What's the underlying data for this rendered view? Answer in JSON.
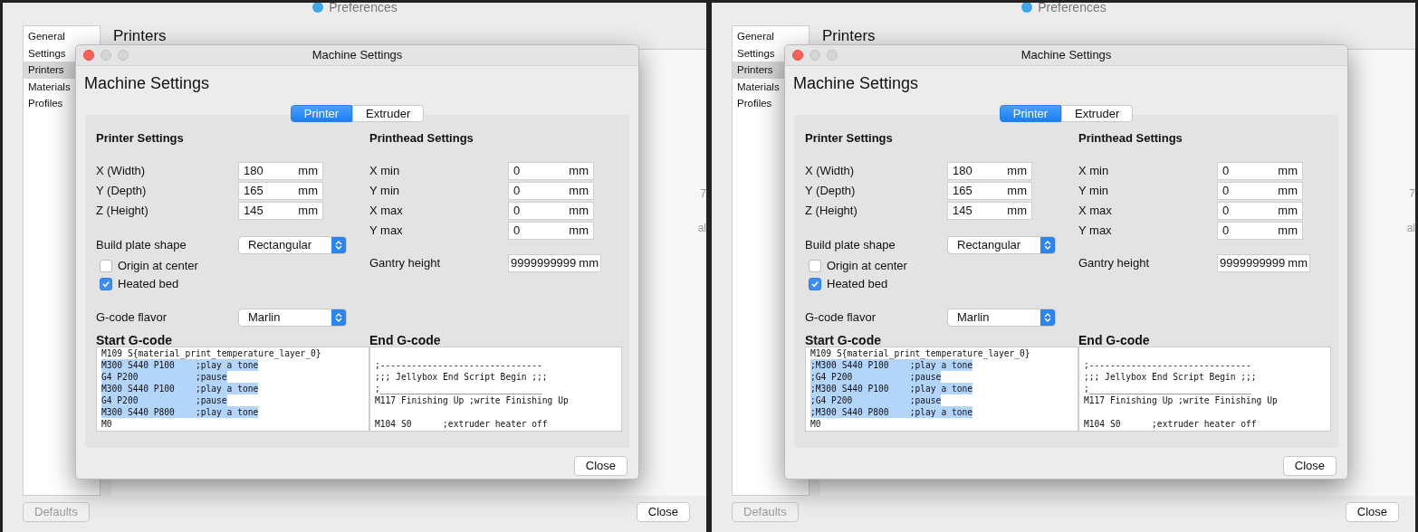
{
  "panels": [
    {
      "window_title": "Preferences",
      "sidebar": {
        "items": [
          {
            "label": "General",
            "selected": false
          },
          {
            "label": "Settings",
            "selected": false
          },
          {
            "label": "Printers",
            "selected": true
          },
          {
            "label": "Materials",
            "selected": false
          },
          {
            "label": "Profiles",
            "selected": false
          }
        ]
      },
      "heading": "Printers",
      "background_fragments": [
        "7",
        "al"
      ],
      "buttons": [
        "Defaults",
        "Close"
      ],
      "dialog": {
        "title": "Machine Settings",
        "heading": "Machine Settings",
        "tabs": [
          {
            "label": "Printer",
            "selected": true
          },
          {
            "label": "Extruder",
            "selected": false
          }
        ],
        "printer_settings": {
          "title": "Printer Settings",
          "fields": [
            {
              "label": "X (Width)",
              "value": "180",
              "unit": "mm"
            },
            {
              "label": "Y (Depth)",
              "value": "165",
              "unit": "mm"
            },
            {
              "label": "Z (Height)",
              "value": "145",
              "unit": "mm"
            }
          ],
          "build_plate_shape": {
            "label": "Build plate shape",
            "value": "Rectangular"
          },
          "checkboxes": [
            {
              "label": "Origin at center",
              "checked": false
            },
            {
              "label": "Heated bed",
              "checked": true
            }
          ],
          "gcode_flavor": {
            "label": "G-code flavor",
            "value": "Marlin"
          }
        },
        "printhead_settings": {
          "title": "Printhead Settings",
          "fields": [
            {
              "label": "X min",
              "value": "0",
              "unit": "mm"
            },
            {
              "label": "Y min",
              "value": "0",
              "unit": "mm"
            },
            {
              "label": "X max",
              "value": "0",
              "unit": "mm"
            },
            {
              "label": "Y max",
              "value": "0",
              "unit": "mm"
            }
          ],
          "gantry_height": {
            "label": "Gantry height",
            "value": "9999999999",
            "unit": "mm"
          }
        },
        "start_gcode": {
          "title": "Start G-code",
          "lines": [
            {
              "text": "M109 S{material_print_temperature_layer_0}",
              "selected": false
            },
            {
              "text": "M300 S440 P100    ;play a tone",
              "selected": true
            },
            {
              "text": "G4 P200           ;pause",
              "selected": true
            },
            {
              "text": "M300 S440 P100    ;play a tone",
              "selected": true
            },
            {
              "text": "G4 P200           ;pause",
              "selected": true
            },
            {
              "text": "M300 S440 P800    ;play a tone",
              "selected": true
            },
            {
              "text": "M0",
              "selected": false
            }
          ]
        },
        "end_gcode": {
          "title": "End G-code",
          "lines": [
            {
              "kind": "blank"
            },
            {
              "kind": "text",
              "text": ";-------------------------------"
            },
            {
              "kind": "text",
              "text": ";;; Jellybox End Script Begin ;;;"
            },
            {
              "kind": "text",
              "text": ";_______________________________"
            },
            {
              "kind": "text",
              "text": "M117 Finishing Up ;write Finishing Up"
            },
            {
              "kind": "blank"
            },
            {
              "kind": "text",
              "text": "M104 S0      ;extruder heater off"
            }
          ]
        },
        "close_button": "Close"
      }
    },
    {
      "window_title": "Preferences",
      "sidebar": {
        "items": [
          {
            "label": "General",
            "selected": false
          },
          {
            "label": "Settings",
            "selected": false
          },
          {
            "label": "Printers",
            "selected": true
          },
          {
            "label": "Materials",
            "selected": false
          },
          {
            "label": "Profiles",
            "selected": false
          }
        ]
      },
      "heading": "Printers",
      "background_fragments": [
        "7",
        "al"
      ],
      "buttons": [
        "Defaults",
        "Close"
      ],
      "dialog": {
        "title": "Machine Settings",
        "heading": "Machine Settings",
        "tabs": [
          {
            "label": "Printer",
            "selected": true
          },
          {
            "label": "Extruder",
            "selected": false
          }
        ],
        "printer_settings": {
          "title": "Printer Settings",
          "fields": [
            {
              "label": "X (Width)",
              "value": "180",
              "unit": "mm"
            },
            {
              "label": "Y (Depth)",
              "value": "165",
              "unit": "mm"
            },
            {
              "label": "Z (Height)",
              "value": "145",
              "unit": "mm"
            }
          ],
          "build_plate_shape": {
            "label": "Build plate shape",
            "value": "Rectangular"
          },
          "checkboxes": [
            {
              "label": "Origin at center",
              "checked": false
            },
            {
              "label": "Heated bed",
              "checked": true
            }
          ],
          "gcode_flavor": {
            "label": "G-code flavor",
            "value": "Marlin"
          }
        },
        "printhead_settings": {
          "title": "Printhead Settings",
          "fields": [
            {
              "label": "X min",
              "value": "0",
              "unit": "mm"
            },
            {
              "label": "Y min",
              "value": "0",
              "unit": "mm"
            },
            {
              "label": "X max",
              "value": "0",
              "unit": "mm"
            },
            {
              "label": "Y max",
              "value": "0",
              "unit": "mm"
            }
          ],
          "gantry_height": {
            "label": "Gantry height",
            "value": "9999999999",
            "unit": "mm"
          }
        },
        "start_gcode": {
          "title": "Start G-code",
          "lines": [
            {
              "text": "M109 S{material_print_temperature_layer_0}",
              "selected": false
            },
            {
              "text": ";M300 S440 P100    ;play a tone",
              "selected": true
            },
            {
              "text": ";G4 P200           ;pause",
              "selected": true
            },
            {
              "text": ";M300 S440 P100    ;play a tone",
              "selected": true
            },
            {
              "text": ";G4 P200           ;pause",
              "selected": true
            },
            {
              "text": ";M300 S440 P800    ;play a tone",
              "selected": true
            },
            {
              "text": "M0",
              "selected": false
            }
          ]
        },
        "end_gcode": {
          "title": "End G-code",
          "lines": [
            {
              "kind": "blank"
            },
            {
              "kind": "text",
              "text": ";-------------------------------"
            },
            {
              "kind": "text",
              "text": ";;; Jellybox End Script Begin ;;;"
            },
            {
              "kind": "text",
              "text": ";_______________________________"
            },
            {
              "kind": "text",
              "text": "M117 Finishing Up ;write Finishing Up"
            },
            {
              "kind": "blank"
            },
            {
              "kind": "text",
              "text": "M104 S0      ;extruder heater off"
            }
          ]
        },
        "close_button": "Close"
      }
    }
  ]
}
